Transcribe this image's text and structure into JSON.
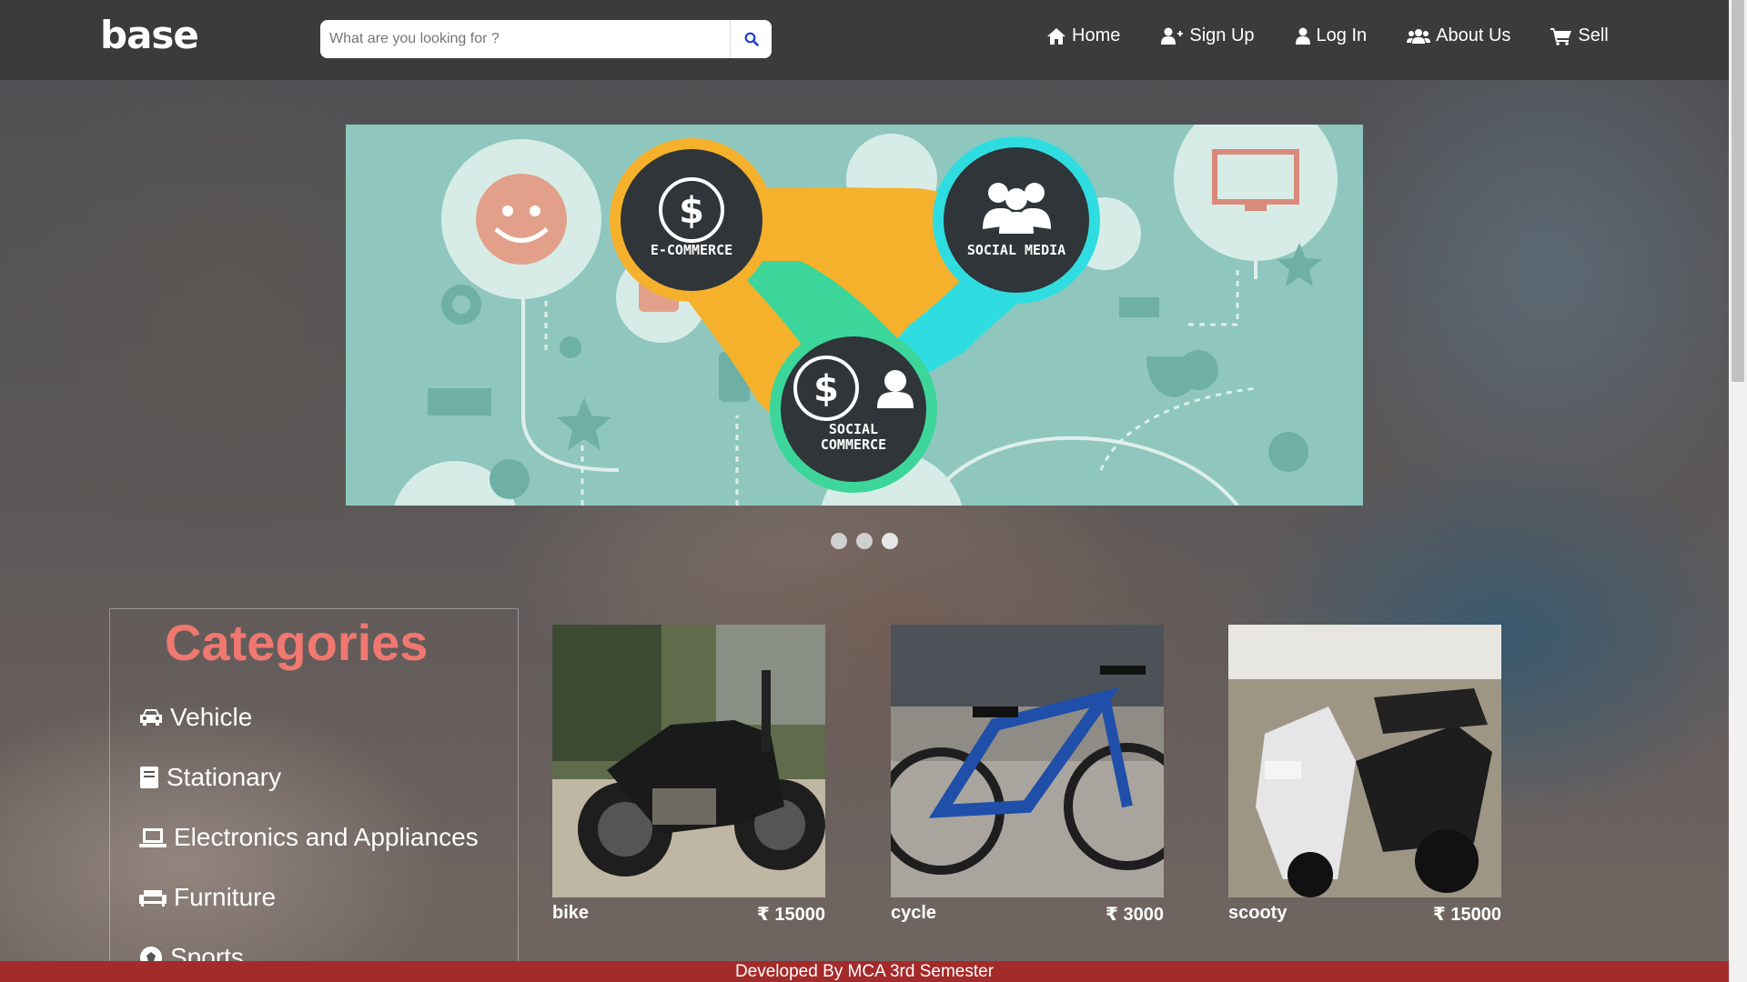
{
  "brand": {
    "logo": "base"
  },
  "search": {
    "placeholder": "What are you looking for ?",
    "icon": "search-icon"
  },
  "nav": {
    "items": [
      {
        "label": "Home",
        "icon": "home-icon"
      },
      {
        "label": "Sign Up",
        "icon": "user-plus-icon"
      },
      {
        "label": "Log In",
        "icon": "user-icon"
      },
      {
        "label": "About Us",
        "icon": "users-icon"
      },
      {
        "label": "Sell",
        "icon": "cart-icon"
      }
    ]
  },
  "carousel": {
    "slides_count": 3,
    "active_slide": 1,
    "banner_labels": {
      "ecommerce": "E-COMMERCE",
      "social_media": "SOCIAL MEDIA",
      "social_commerce_1": "SOCIAL",
      "social_commerce_2": "COMMERCE"
    }
  },
  "categories": {
    "title": "Categories",
    "items": [
      {
        "label": "Vehicle",
        "icon": "car-icon"
      },
      {
        "label": "Stationary",
        "icon": "book-icon"
      },
      {
        "label": "Electronics and Appliances",
        "icon": "laptop-icon"
      },
      {
        "label": "Furniture",
        "icon": "couch-icon"
      },
      {
        "label": "Sports",
        "icon": "football-icon"
      }
    ]
  },
  "products": [
    {
      "name": "bike",
      "price": "₹ 15000"
    },
    {
      "name": "cycle",
      "price": "₹ 3000"
    },
    {
      "name": "scooty",
      "price": "₹ 15000"
    }
  ],
  "footer": {
    "text": "Developed By MCA 3rd Semester"
  },
  "colors": {
    "navbar": "#3b3b3b",
    "accent_title": "#f07870",
    "footer": "#a52a2a",
    "banner_bg": "#8fc7be"
  }
}
